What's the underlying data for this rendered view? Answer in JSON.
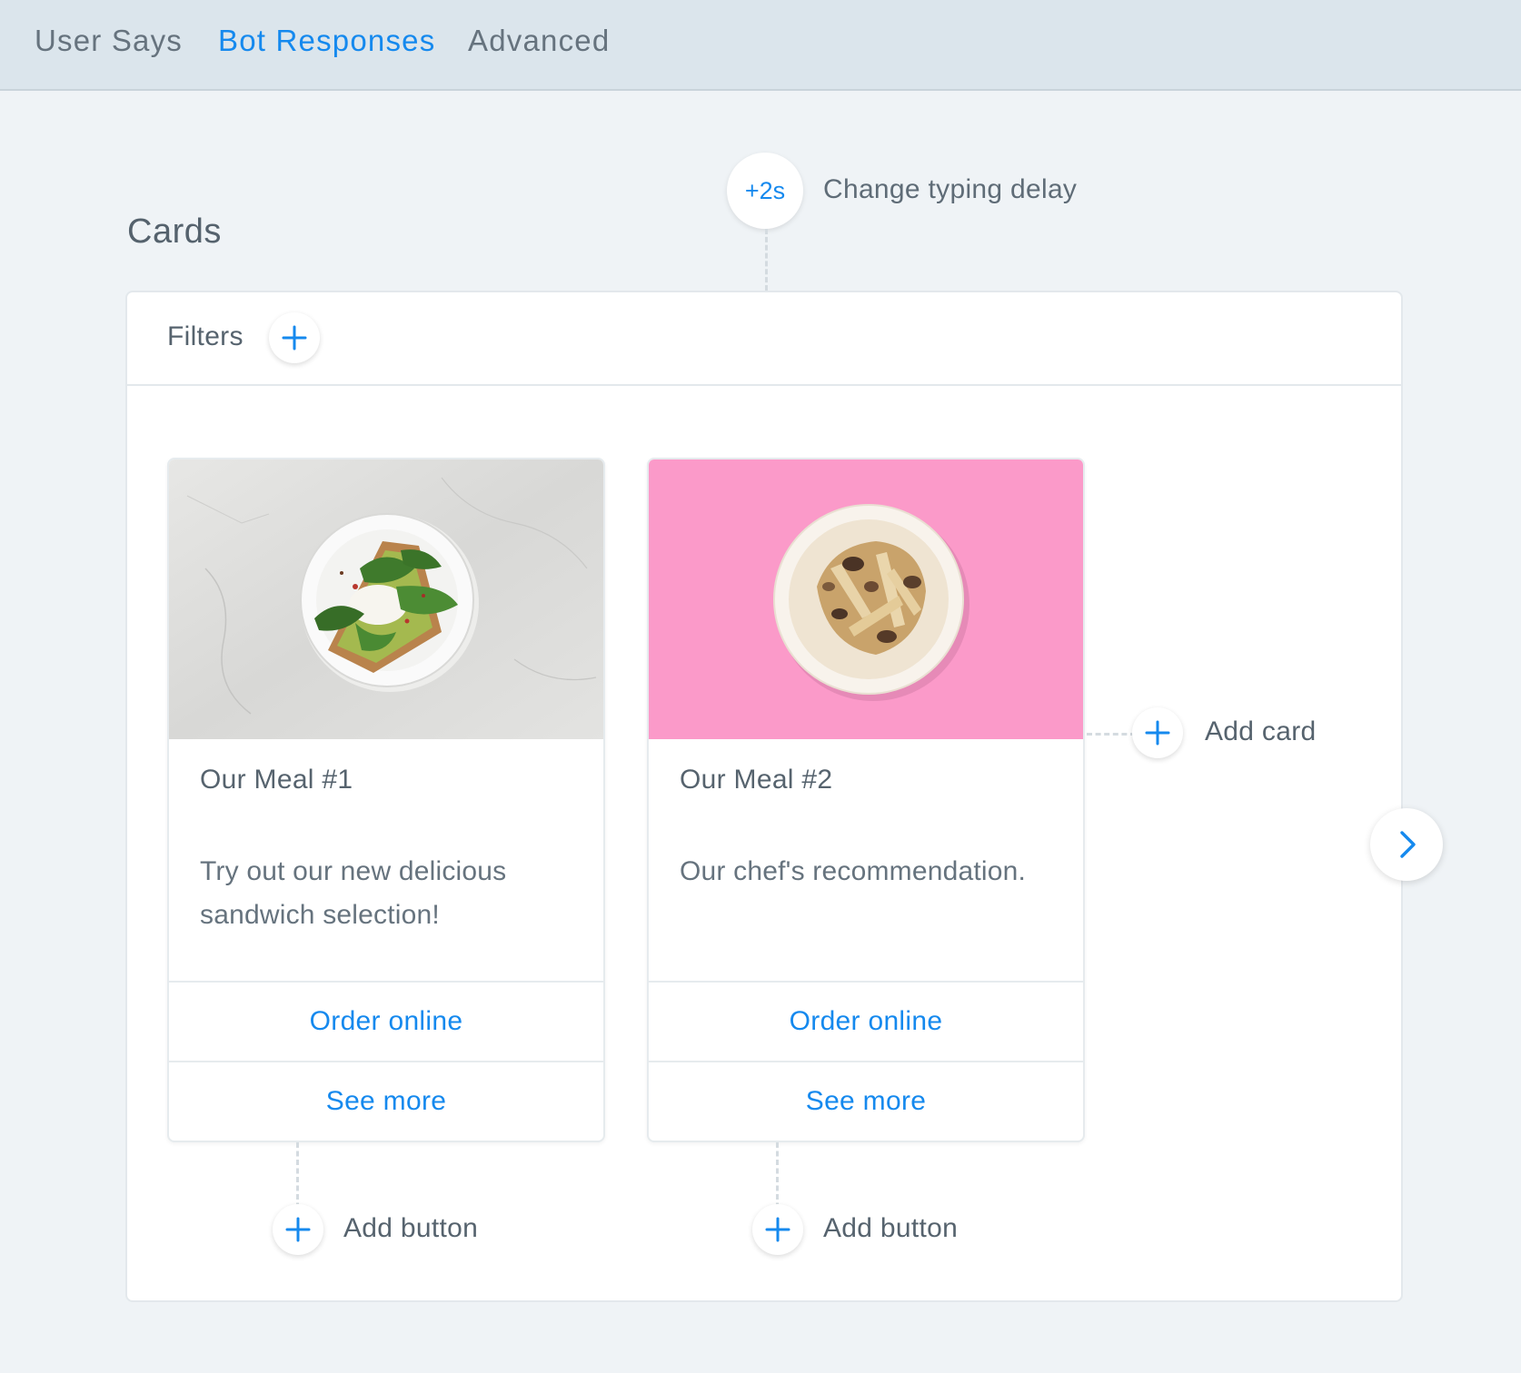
{
  "tabs": [
    {
      "label": "User Says",
      "active": false
    },
    {
      "label": "Bot Responses",
      "active": true
    },
    {
      "label": "Advanced",
      "active": false
    }
  ],
  "section": {
    "title": "Cards"
  },
  "typing_delay": {
    "value": "+2s",
    "label": "Change typing delay"
  },
  "filters": {
    "label": "Filters",
    "add_icon": "plus-icon"
  },
  "cards": [
    {
      "title": "Our Meal #1",
      "description": "Try out our new delicious sandwich selection!",
      "image": "toast-with-spinach-on-marble",
      "buttons": [
        "Order online",
        "See more"
      ],
      "add_button_label": "Add button"
    },
    {
      "title": "Our Meal #2",
      "description": "Our chef's recommendation.",
      "image": "mushroom-pasta-on-pink",
      "buttons": [
        "Order online",
        "See more"
      ],
      "add_button_label": "Add button"
    }
  ],
  "add_card": {
    "label": "Add card",
    "icon": "plus-icon"
  },
  "next": {
    "icon": "chevron-right-icon"
  },
  "colors": {
    "accent": "#1589ee",
    "tabbar_bg": "#dbe5ec",
    "page_bg": "#eff3f6",
    "card_2_bg": "#fb9ac9"
  }
}
